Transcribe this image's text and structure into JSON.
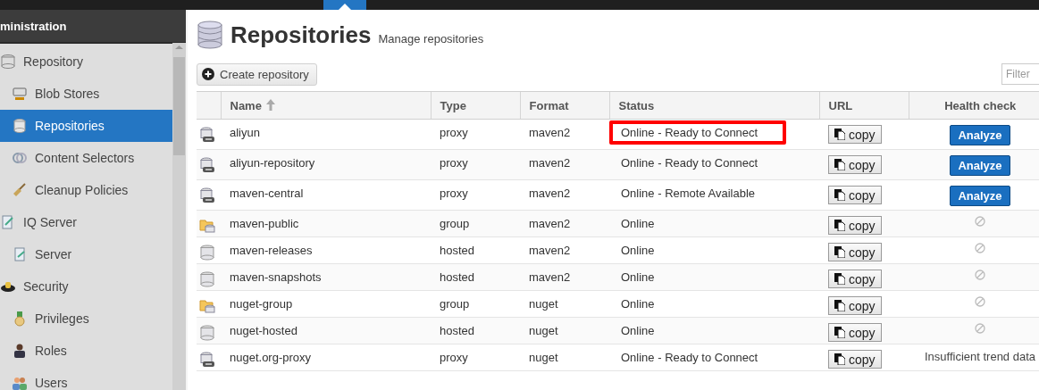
{
  "sidebar": {
    "header": "ministration",
    "items": [
      {
        "label": "Repository",
        "kind": "database",
        "selected": false,
        "children": [
          {
            "label": "Blob Stores",
            "kind": "server",
            "selected": false
          },
          {
            "label": "Repositories",
            "kind": "database",
            "selected": true
          },
          {
            "label": "Content Selectors",
            "kind": "rings",
            "selected": false
          },
          {
            "label": "Cleanup Policies",
            "kind": "broom",
            "selected": false
          }
        ]
      },
      {
        "label": "IQ Server",
        "kind": "doc",
        "selected": false,
        "children": [
          {
            "label": "Server",
            "kind": "doc",
            "selected": false
          }
        ]
      },
      {
        "label": "Security",
        "kind": "cap",
        "selected": false,
        "children": [
          {
            "label": "Privileges",
            "kind": "medal",
            "selected": false
          },
          {
            "label": "Roles",
            "kind": "person",
            "selected": false
          },
          {
            "label": "Users",
            "kind": "people",
            "selected": false
          }
        ]
      }
    ]
  },
  "page": {
    "title": "Repositories",
    "subtitle": "Manage repositories"
  },
  "toolbar": {
    "create_button": "Create repository",
    "filter": {
      "placeholder": "Filter"
    }
  },
  "table": {
    "columns": [
      {
        "label": "Name",
        "sorted": true
      },
      {
        "label": "Type",
        "sorted": false
      },
      {
        "label": "Format",
        "sorted": false
      },
      {
        "label": "Status",
        "sorted": false
      },
      {
        "label": "URL",
        "sorted": false
      },
      {
        "label": "Health check",
        "sorted": false
      }
    ],
    "rows": [
      {
        "kind": "proxy",
        "name": "aliyun",
        "type": "proxy",
        "format": "maven2",
        "status": "Online - Ready to Connect",
        "highlighted": true,
        "url_button": "copy",
        "health": {
          "kind": "button",
          "text": "Analyze"
        }
      },
      {
        "kind": "proxy",
        "name": "aliyun-repository",
        "type": "proxy",
        "format": "maven2",
        "status": "Online - Ready to Connect",
        "highlighted": false,
        "url_button": "copy",
        "health": {
          "kind": "button",
          "text": "Analyze"
        }
      },
      {
        "kind": "proxy",
        "name": "maven-central",
        "type": "proxy",
        "format": "maven2",
        "status": "Online - Remote Available",
        "highlighted": false,
        "url_button": "copy",
        "health": {
          "kind": "button",
          "text": "Analyze"
        }
      },
      {
        "kind": "group",
        "name": "maven-public",
        "type": "group",
        "format": "maven2",
        "status": "Online",
        "highlighted": false,
        "url_button": "copy",
        "health": {
          "kind": "unavailable"
        }
      },
      {
        "kind": "hosted",
        "name": "maven-releases",
        "type": "hosted",
        "format": "maven2",
        "status": "Online",
        "highlighted": false,
        "url_button": "copy",
        "health": {
          "kind": "unavailable"
        }
      },
      {
        "kind": "hosted",
        "name": "maven-snapshots",
        "type": "hosted",
        "format": "maven2",
        "status": "Online",
        "highlighted": false,
        "url_button": "copy",
        "health": {
          "kind": "unavailable"
        }
      },
      {
        "kind": "group",
        "name": "nuget-group",
        "type": "group",
        "format": "nuget",
        "status": "Online",
        "highlighted": false,
        "url_button": "copy",
        "health": {
          "kind": "unavailable"
        }
      },
      {
        "kind": "hosted",
        "name": "nuget-hosted",
        "type": "hosted",
        "format": "nuget",
        "status": "Online",
        "highlighted": false,
        "url_button": "copy",
        "health": {
          "kind": "unavailable"
        }
      },
      {
        "kind": "proxy",
        "name": "nuget.org-proxy",
        "type": "proxy",
        "format": "nuget",
        "status": "Online - Ready to Connect",
        "highlighted": false,
        "url_button": "copy",
        "health": {
          "kind": "text",
          "text": "Insufficient trend data"
        }
      }
    ]
  }
}
